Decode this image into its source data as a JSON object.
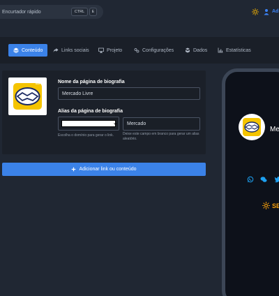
{
  "topbar": {
    "search_label": "Encurtador rápido",
    "shortcut_ctrl": "CTRL",
    "shortcut_e": "E",
    "profile_label": "Ad"
  },
  "tabs": [
    {
      "label": "Conteúdo",
      "icon": "layers-icon",
      "active": true
    },
    {
      "label": "Links sociais",
      "icon": "share-icon",
      "active": false
    },
    {
      "label": "Projeto",
      "icon": "monitor-icon",
      "active": false
    },
    {
      "label": "Configurações",
      "icon": "settings-icon",
      "active": false
    },
    {
      "label": "Dados",
      "icon": "database-icon",
      "active": false
    },
    {
      "label": "Estatísticas",
      "icon": "chart-icon",
      "active": false
    }
  ],
  "form": {
    "bio_name_title": "Nome da página de biografia",
    "bio_name_value": "Mercado Livre",
    "alias_title": "Alias da página de biografia",
    "alias_value": "Mercado",
    "domain_help": "Escolha o domínio para gerar o link.",
    "alias_help": "Deixe este campo em branco para gerar um alias aleatório."
  },
  "add_button": {
    "label": "Adicionar link ou conteúdo",
    "icon": "plus-icon"
  },
  "preview": {
    "name": "Mercado Livre",
    "brand_text": "SEU MERCADO",
    "social_icons": [
      "whatsapp-icon",
      "wechat-icon",
      "twitter-icon"
    ]
  },
  "colors": {
    "accent": "#3b82e8",
    "background": "#202733",
    "panel": "#1b2029",
    "brand_yellow": "#ffe600",
    "brand_orange": "#f59e0b"
  }
}
